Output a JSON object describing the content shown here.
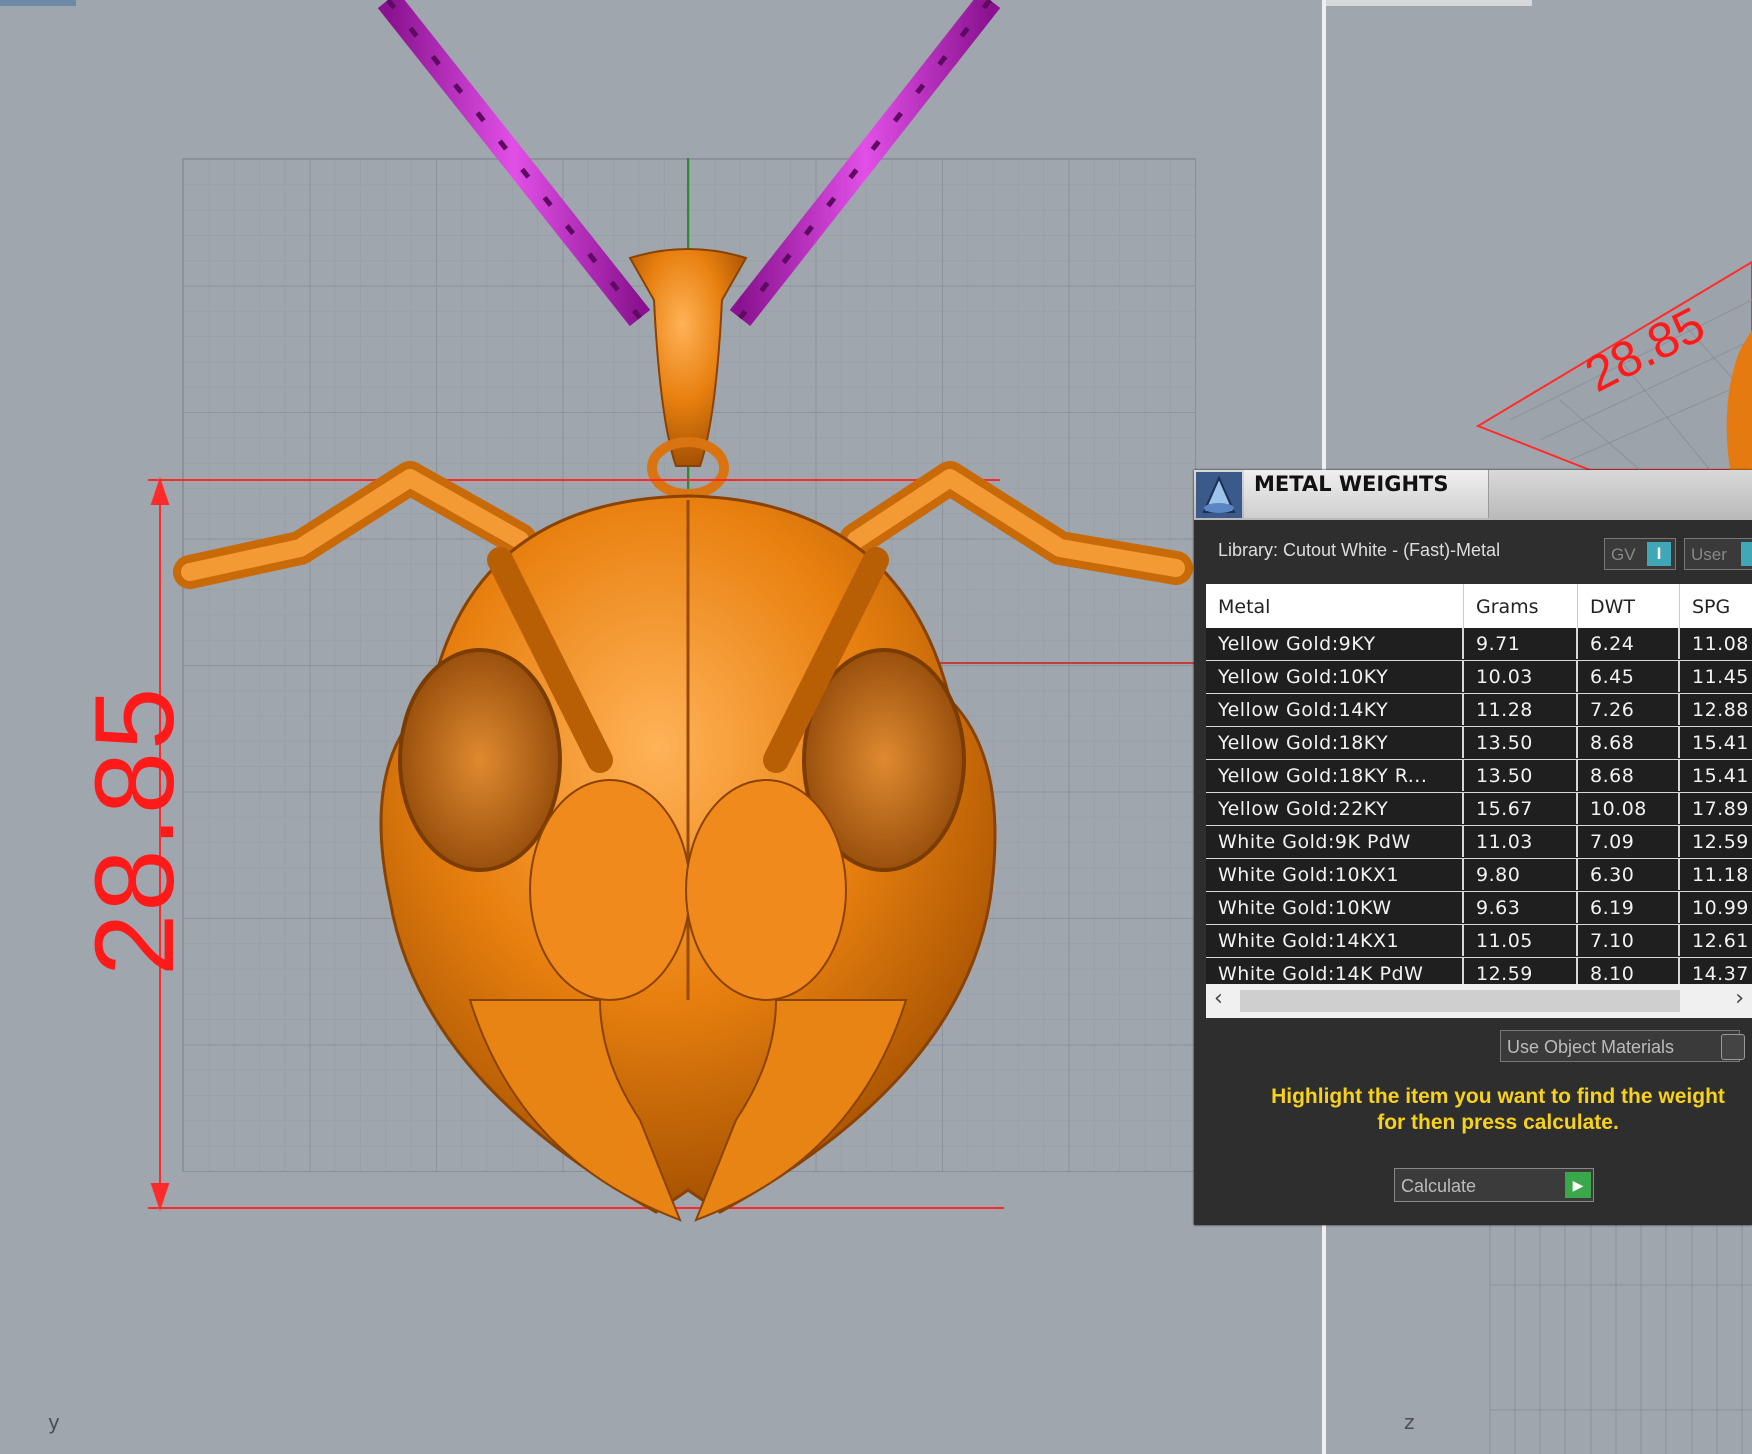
{
  "viewport_left": {
    "axis_label": "y",
    "dimension": "28.85"
  },
  "viewport_right": {
    "axis_label": "z",
    "dimension": "28.85"
  },
  "panel": {
    "title": "METAL WEIGHTS",
    "library": "Library: Cutout White - (Fast)-Metal",
    "gv_label": "GV",
    "gv_button": "I",
    "user_label": "User",
    "columns": [
      "Metal",
      "Grams",
      "DWT",
      "SPG"
    ],
    "rows": [
      [
        "Yellow Gold:9KY",
        "9.71",
        "6.24",
        "11.08"
      ],
      [
        "Yellow Gold:10KY",
        "10.03",
        "6.45",
        "11.45"
      ],
      [
        "Yellow Gold:14KY",
        "11.28",
        "7.26",
        "12.88"
      ],
      [
        "Yellow Gold:18KY",
        "13.50",
        "8.68",
        "15.41"
      ],
      [
        "Yellow Gold:18KY R...",
        "13.50",
        "8.68",
        "15.41"
      ],
      [
        "Yellow Gold:22KY",
        "15.67",
        "10.08",
        "17.89"
      ],
      [
        "White Gold:9K PdW",
        "11.03",
        "7.09",
        "12.59"
      ],
      [
        "White Gold:10KX1",
        "9.80",
        "6.30",
        "11.18"
      ],
      [
        "White Gold:10KW",
        "9.63",
        "6.19",
        "10.99"
      ],
      [
        "White Gold:14KX1",
        "11.05",
        "7.10",
        "12.61"
      ],
      [
        "White Gold:14K PdW",
        "12.59",
        "8.10",
        "14.37"
      ]
    ],
    "use_object_materials": "Use Object Materials",
    "hint_line1": "Highlight the item you want to find the weight",
    "hint_line2": "for then press calculate.",
    "calculate_label": "Calculate"
  },
  "colors": {
    "metal": "#e07a10",
    "chain": "#c21dc9",
    "dimension": "#ff1a1a",
    "hint": "#f7d11c"
  }
}
